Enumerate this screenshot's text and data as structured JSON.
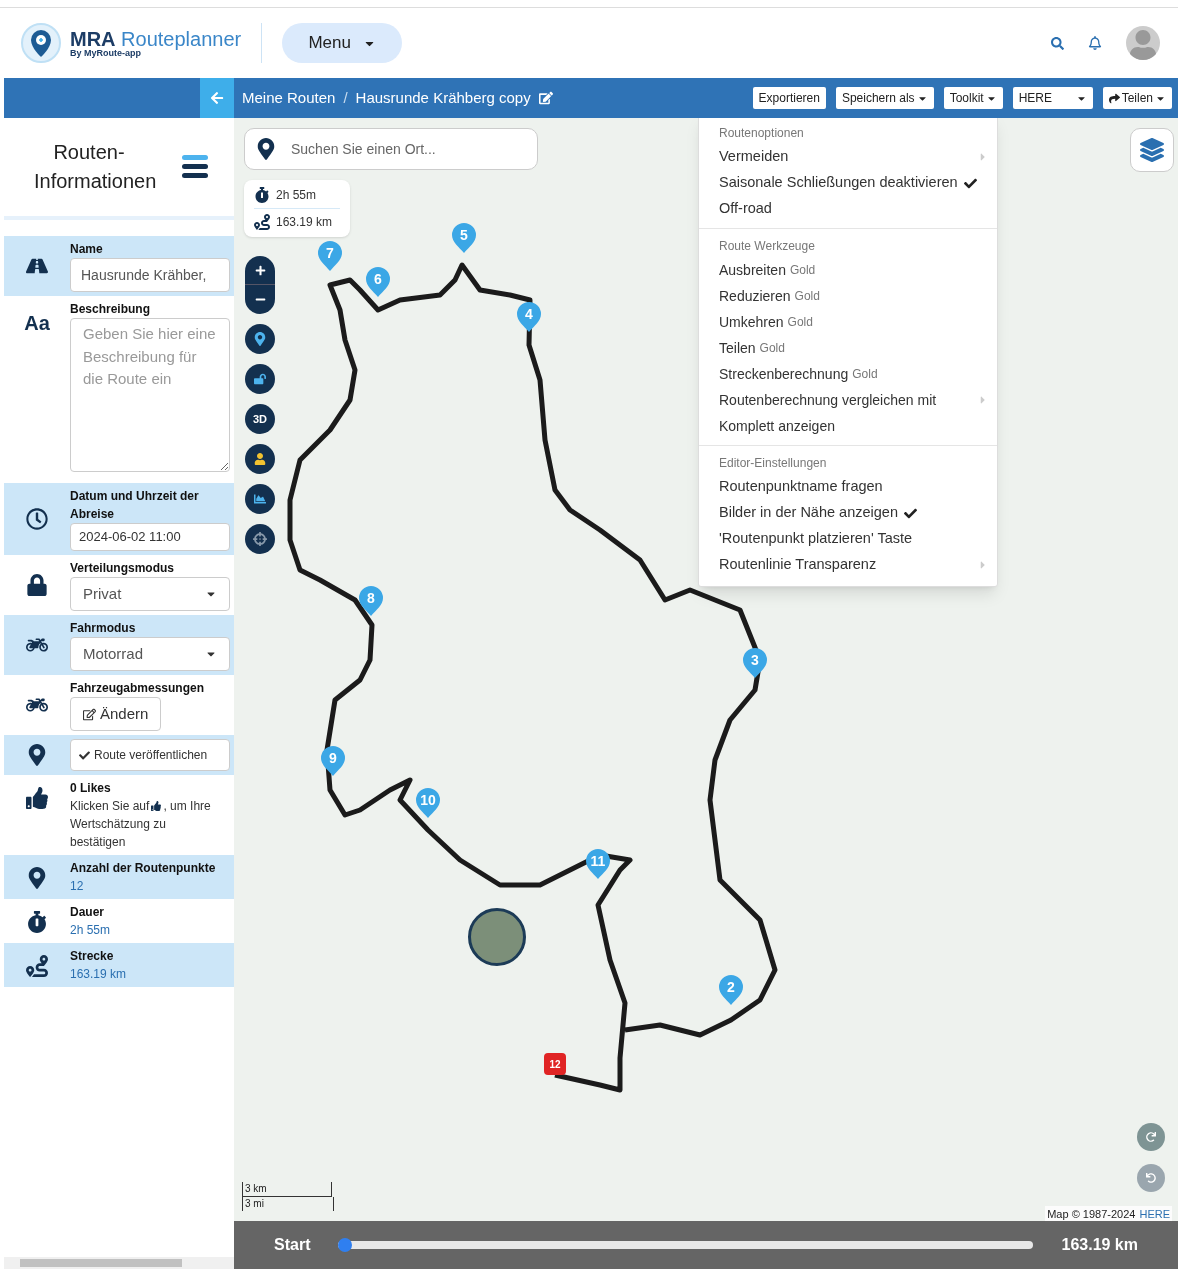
{
  "header": {
    "brand": "MRA",
    "product": "Routeplanner",
    "byline": "By MyRoute-",
    "byline_bold": "app",
    "menu_button": "Menu"
  },
  "toolbar": {
    "breadcrumb": [
      "Meine Routen",
      "Hausrunde Krähberg copy"
    ],
    "separator": "/",
    "buttons": [
      {
        "label": "Exportieren",
        "kind": "plain"
      },
      {
        "label": "Speichern als",
        "kind": "dropdown"
      },
      {
        "label": "Toolkit",
        "kind": "dropdown"
      },
      {
        "label": "HERE",
        "kind": "select"
      },
      {
        "label": "Teilen",
        "kind": "share"
      }
    ]
  },
  "sidebar": {
    "title": "Routen-Informationen",
    "rows": [
      {
        "kind": "input",
        "label": "Name",
        "value": "Hausrunde Krähber,"
      },
      {
        "kind": "textarea",
        "glyph": "Aa",
        "label": "Beschreibung",
        "placeholder": "Geben Sie hier eine Beschreibung für die Route ein"
      },
      {
        "kind": "input",
        "label": "Datum und Uhrzeit der Abreise",
        "value": "2024-06-02 11:00"
      },
      {
        "kind": "select",
        "label": "Verteilungsmodus",
        "value": "Privat"
      },
      {
        "kind": "select",
        "label": "Fahrmodus",
        "value": "Motorrad"
      },
      {
        "kind": "edit",
        "label": "Fahrzeugabmessungen",
        "value": "Ändern"
      },
      {
        "kind": "publish",
        "value": "Route veröffentlichen"
      },
      {
        "kind": "likes",
        "label": "0 Likes",
        "hint": [
          "Klicken Sie auf",
          ", um Ihre",
          "Wertschätzung zu bestätigen"
        ]
      },
      {
        "kind": "stat",
        "label": "Anzahl der Routenpunkte",
        "value": "12"
      },
      {
        "kind": "stat",
        "label": "Dauer",
        "value": "2h 55m"
      },
      {
        "kind": "stat",
        "label": "Strecke",
        "value": "163.19 km"
      }
    ]
  },
  "map": {
    "search": {
      "placeholder": "Suchen Sie einen Ort..."
    },
    "duration": "2h 55m",
    "distance": "163.19 km",
    "three_d": "3D",
    "waypoints": [
      {
        "label": "7",
        "kind": "pin"
      },
      {
        "label": "6",
        "kind": "pin"
      },
      {
        "label": "5",
        "kind": "pin"
      },
      {
        "label": "4",
        "kind": "pin"
      },
      {
        "label": "8",
        "kind": "pin"
      },
      {
        "label": "3",
        "kind": "pin"
      },
      {
        "label": "9",
        "kind": "pin"
      },
      {
        "label": "10",
        "kind": "pin"
      },
      {
        "label": "11",
        "kind": "pin"
      },
      {
        "label": "2",
        "kind": "pin"
      },
      {
        "label": "12",
        "kind": "end"
      }
    ],
    "scale": [
      "3 km",
      "3 mi"
    ],
    "attribution": "Map © 1987-2024",
    "attribution_link": "HERE"
  },
  "route_menu": {
    "sections": [
      {
        "title": "Routenoptionen",
        "items": [
          {
            "label": "Vermeiden",
            "submenu": true,
            "checked": false
          },
          {
            "label": "Saisonale Schließungen deaktivieren",
            "submenu": false,
            "checked": true
          },
          {
            "label": "Off-road",
            "submenu": false,
            "checked": false
          }
        ]
      },
      {
        "title": "Route Werkzeuge",
        "items": [
          {
            "label": "Ausbreiten",
            "badge": "Gold",
            "submenu": false,
            "checked": false
          },
          {
            "label": "Reduzieren",
            "badge": "Gold",
            "submenu": false,
            "checked": false
          },
          {
            "label": "Umkehren",
            "badge": "Gold",
            "submenu": false,
            "checked": false
          },
          {
            "label": "Teilen",
            "badge": "Gold",
            "submenu": false,
            "checked": false
          },
          {
            "label": "Streckenberechnung",
            "badge": "Gold",
            "submenu": false,
            "checked": false
          },
          {
            "label": "Routenberechnung vergleichen mit",
            "submenu": true,
            "checked": false
          },
          {
            "label": "Komplett anzeigen",
            "submenu": false,
            "checked": false
          }
        ]
      },
      {
        "title": "Editor-Einstellungen",
        "items": [
          {
            "label": "Routenpunktname fragen",
            "submenu": false,
            "checked": false
          },
          {
            "label": "Bilder in der Nähe anzeigen",
            "submenu": false,
            "checked": true
          },
          {
            "label": "'Routenpunkt platzieren' Taste",
            "submenu": false,
            "checked": false
          },
          {
            "label": "Routenlinie Transparenz",
            "submenu": true,
            "checked": false
          }
        ]
      }
    ]
  },
  "playback": {
    "start": "Start",
    "level": 0,
    "end": "163.19 km"
  }
}
